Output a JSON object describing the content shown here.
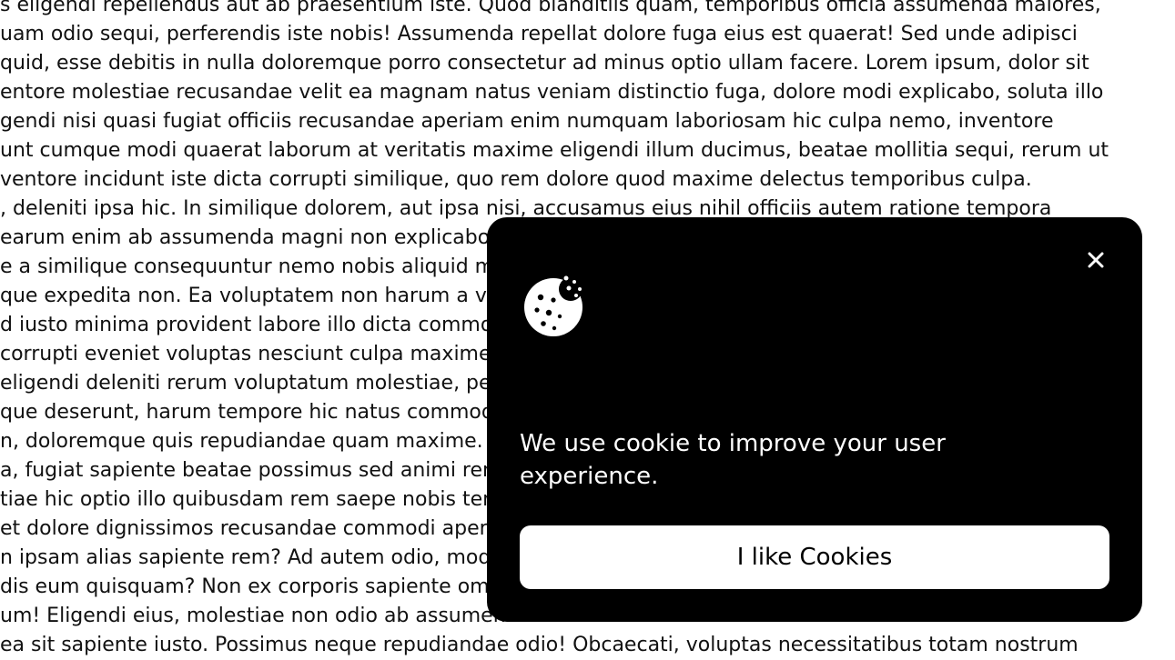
{
  "background": {
    "lines": [
      "s eligendi repellendus aut ab praesentium iste. Quod blanditiis quam, temporibus officia assumenda maiores,",
      "uam odio sequi, perferendis iste nobis! Assumenda repellat dolore fuga eius est quaerat! Sed unde adipisci",
      "quid, esse debitis in nulla doloremque porro consectetur ad minus optio ullam facere. Lorem ipsum, dolor sit",
      "entore molestiae recusandae velit ea magnam natus veniam distinctio fuga, dolore modi explicabo, soluta illo",
      "gendi nisi quasi fugiat officiis recusandae aperiam enim numquam laboriosam hic culpa nemo, inventore",
      "unt cumque modi quaerat laborum at veritatis maxime eligendi illum ducimus, beatae mollitia sequi, rerum ut",
      "ventore incidunt iste dicta corrupti similique, quo rem dolore quod maxime delectus temporibus culpa.",
      ", deleniti ipsa hic. In similique dolorem, aut ipsa nisi, accusamus eius nihil officiis autem ratione tempora",
      "earum enim ab assumenda magni non explicabo",
      "e a similique consequuntur nemo nobis aliquid m",
      "que expedita non. Ea voluptatem non harum a ve",
      "d iusto minima provident labore illo dicta commo",
      "corrupti eveniet voluptas nesciunt culpa maxime",
      "eligendi deleniti rerum voluptatum molestiae, pe",
      "que deserunt, harum tempore hic natus commod",
      "n, doloremque quis repudiandae quam maxime. A",
      "a, fugiat sapiente beatae possimus sed animi rem",
      "tiae hic optio illo quibusdam rem saepe nobis ten",
      "et dolore dignissimos recusandae commodi aperia",
      "n ipsam alias sapiente rem? Ad autem odio, mod",
      "dis eum quisquam? Non ex corporis sapiente om",
      "um! Eligendi eius, molestiae non odio ab assumen",
      " ea sit sapiente iusto. Possimus neque repudiandae odio! Obcaecati, voluptas necessitatibus totam nostrum"
    ]
  },
  "cookie_popup": {
    "close_icon": "close-icon",
    "cookie_icon": "cookie-icon",
    "message": "We use cookie to improve your user experience.",
    "button_label": "I like Cookies",
    "background_color": "#000000",
    "text_color": "#ffffff"
  }
}
